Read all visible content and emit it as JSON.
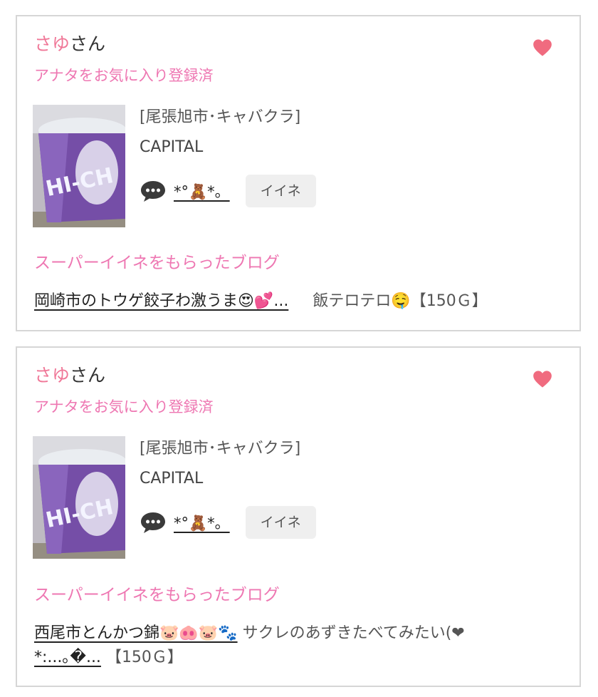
{
  "cards": [
    {
      "name_pink": "さゆ",
      "name_suffix": "さん",
      "favorite_status": "アナタをお気に入り登録済",
      "shop_area": "[尾張旭市･キャバクラ]",
      "shop_name": "CAPITAL",
      "nickname": "*°🧸*。",
      "iine_label": "イイネ",
      "section_title": "スーパーイイネをもらったブログ",
      "blog_title": "岡崎市のトウゲ餃子わ激うま😍💕...",
      "blog_desc": "飯テロテロ🤤【150Ｇ】"
    },
    {
      "name_pink": "さゆ",
      "name_suffix": "さん",
      "favorite_status": "アナタをお気に入り登録済",
      "shop_area": "[尾張旭市･キャバクラ]",
      "shop_name": "CAPITAL",
      "nickname": "*°🧸*。",
      "iine_label": "イイネ",
      "section_title": "スーパーイイネをもらったブログ",
      "blog_title": "西尾市とんかつ錦🐷🐽🐷🐾",
      "blog_desc": "サクレのあずきたべてみたい(❤",
      "blog_title_cont": "*:...｡�...",
      "blog_points": "【150Ｇ】"
    }
  ],
  "colors": {
    "accent_pink": "#ee77b2",
    "heart": "#f06b7f",
    "border": "#d6d6d6"
  },
  "icons": [
    "heart-icon",
    "speech-bubble-icon"
  ]
}
